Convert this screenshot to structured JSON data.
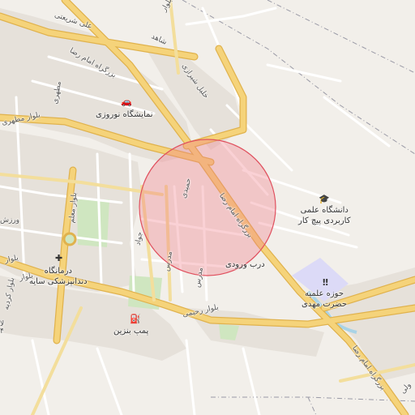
{
  "colors": {
    "land": "#f2efea",
    "block": "#e6e1da",
    "park": "#cfe6c0",
    "highway": "#f5d37a",
    "highway_edge": "#e0b24d",
    "minor": "#ffffff",
    "boundary": "#9a9aa6",
    "highlight_fill": "#f07a86",
    "highlight_stroke": "#e0505e",
    "campus": "#dcdaf7",
    "river": "#a9d3e6"
  },
  "roads": {
    "ali_shariati": "علی شریعتی",
    "shahed": "شاهد",
    "bozorgrah_imam_reza_top": "بزرگراه امام رضا",
    "bozorgrah_imam_reza_mid": "بزرگراه امام رضا",
    "bozorgrah_imam_reza_bottom": "بزرگراه امام رضا",
    "khalil_shirazi": "خلیل شیرازی",
    "motahari": "مطهری",
    "boulevard_motahari": "بلوار مطهری",
    "hamidi": "حمیدی",
    "javad": "جواد",
    "modarres": "مدرس",
    "modarres_2": "مدرس",
    "boulevard_moallem": "بلوار معلم",
    "boulevard_rahimi": "بلوار رحیمی",
    "boulevard_left": "بلوار",
    "boulevard_left_2": "بلوار",
    "varzesh": "ورزش",
    "valiasr": "ولی",
    "bolvar_kordieh": "بلوار کردیه"
  },
  "pois": {
    "car_showroom": {
      "label": "نمایشگاه نوروزی",
      "icon": "car-icon"
    },
    "university": {
      "label": "دانشگاه علمی\nکاربردی پیچ کار",
      "icon": "graduation-cap-icon"
    },
    "dental_clinic": {
      "label": "درمانگاه\nدندانپزشکی سایه",
      "icon": "medical-cross-icon"
    },
    "seminary": {
      "label": "حوزه علمیه\nحضرت مهدی",
      "icon": "seminary-icon"
    },
    "gas_station": {
      "label": "پمپ بنزین",
      "icon": "fuel-pump-icon"
    },
    "entrance": {
      "label": "درب ورودی"
    }
  },
  "fragments": {
    "edge_left": "ورز",
    "edge_bottom_left": "لا\n۴",
    "edge_top": "بلوار"
  }
}
